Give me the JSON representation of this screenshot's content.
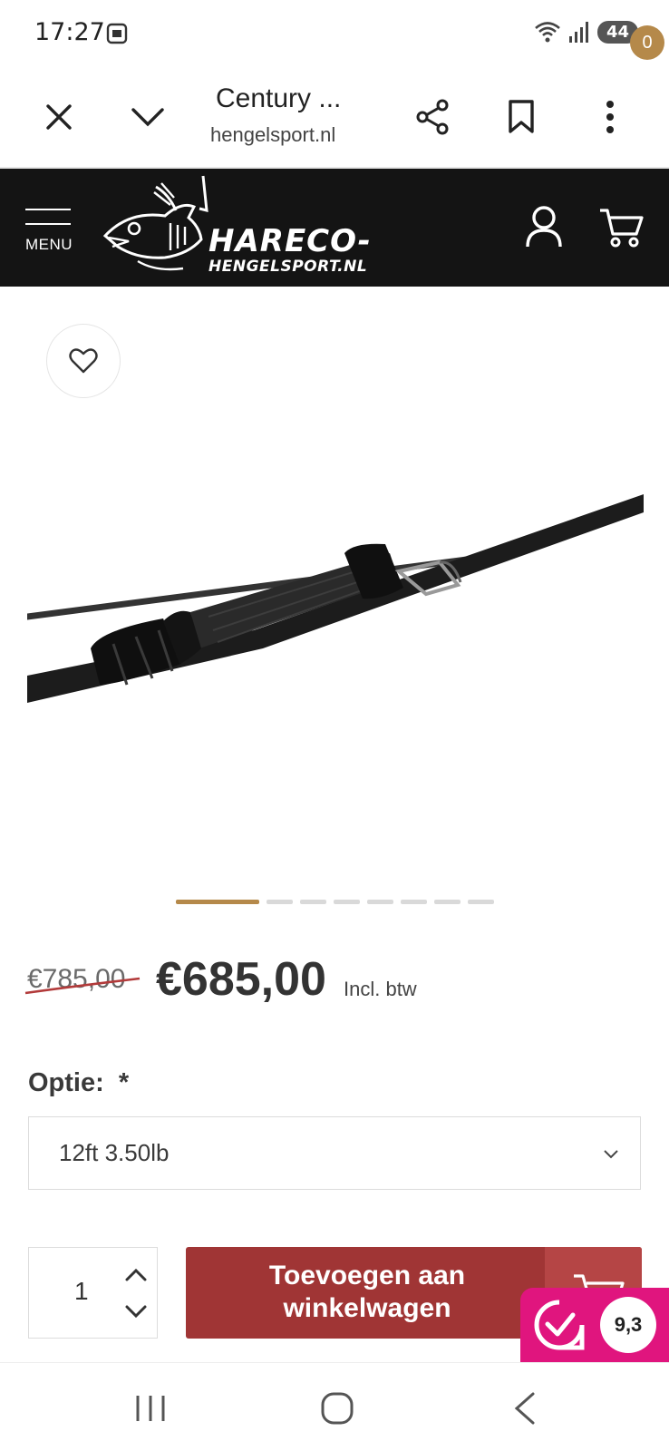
{
  "status_bar": {
    "time": "17:27",
    "battery": "44",
    "icons": [
      "screenshot-icon",
      "wifi-icon",
      "signal-icon"
    ]
  },
  "browser": {
    "title": "Century ...",
    "url": "hengelsport.nl",
    "actions": [
      "close-icon",
      "chevron-down-icon",
      "share-icon",
      "bookmark-icon",
      "more-vert-icon"
    ]
  },
  "site_header": {
    "menu_label": "MENU",
    "logo_line1": "HARECO-",
    "logo_line2": "HENGELSPORT.NL",
    "cart_count": "0"
  },
  "product": {
    "old_price": "€785,00",
    "new_price": "€685,00",
    "vat_label": "Incl. btw",
    "gallery": {
      "total_slides": 8,
      "active_slide": 1
    }
  },
  "option": {
    "label": "Optie:",
    "required_mark": "*",
    "selected": "12ft 3.50lb"
  },
  "purchase": {
    "quantity": "1",
    "add_button_line1": "Toevoegen aan",
    "add_button_line2": "winkelwagen"
  },
  "rating": {
    "score": "9,3"
  },
  "colors": {
    "header_bg": "#141414",
    "accent_gold": "#b5894a",
    "cta_red": "#a03535",
    "rating_pink": "#e0157e"
  }
}
